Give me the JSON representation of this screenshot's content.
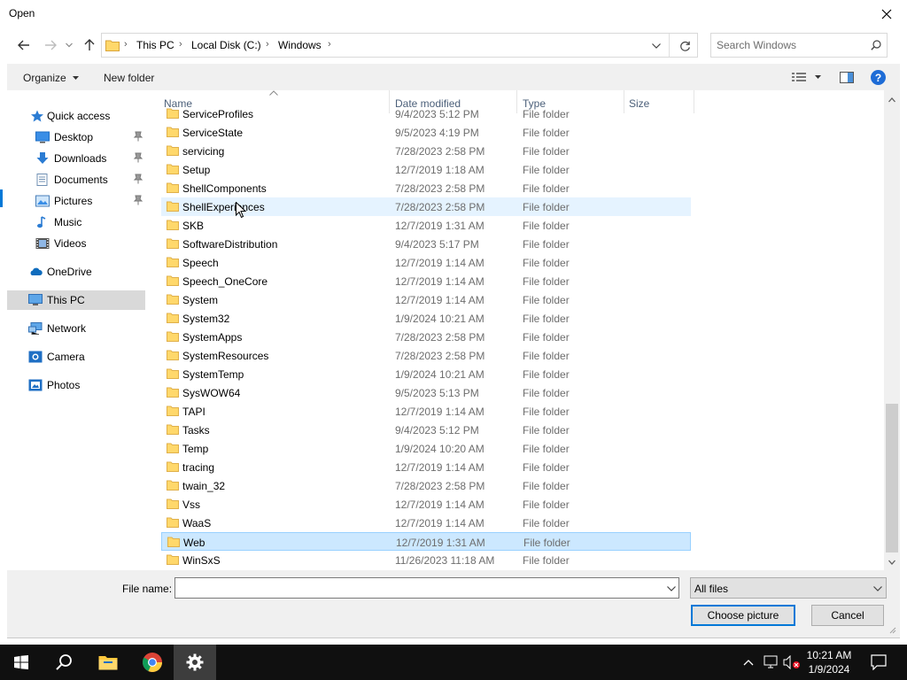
{
  "window": {
    "title": "Open",
    "close_glyph": "✕"
  },
  "nav": {
    "back_icon": "back-arrow-icon",
    "forward_icon": "forward-arrow-icon",
    "recent_icon": "chevron-down-icon",
    "up_icon": "up-arrow-icon",
    "breadcrumb": [
      "This PC",
      "Local Disk (C:)",
      "Windows"
    ],
    "search_placeholder": "Search Windows"
  },
  "toolbar": {
    "organize_label": "Organize",
    "new_folder_label": "New folder",
    "help_glyph": "?"
  },
  "sidebar": {
    "items": [
      {
        "label": "Quick access",
        "icon": "star-icon"
      },
      {
        "label": "Desktop",
        "icon": "desktop-icon",
        "pinned": true
      },
      {
        "label": "Downloads",
        "icon": "download-icon",
        "pinned": true
      },
      {
        "label": "Documents",
        "icon": "documents-icon",
        "pinned": true
      },
      {
        "label": "Pictures",
        "icon": "pictures-icon",
        "pinned": true
      },
      {
        "label": "Music",
        "icon": "music-icon"
      },
      {
        "label": "Videos",
        "icon": "videos-icon"
      },
      {
        "label": "OneDrive",
        "icon": "cloud-icon"
      },
      {
        "label": "This PC",
        "icon": "computer-icon",
        "selected": true
      },
      {
        "label": "Network",
        "icon": "network-icon"
      },
      {
        "label": "Camera",
        "icon": "camera-icon"
      },
      {
        "label": "Photos",
        "icon": "photos-icon"
      }
    ]
  },
  "columns": {
    "name": "Name",
    "date": "Date modified",
    "type": "Type",
    "size": "Size"
  },
  "files": [
    {
      "name": "ServiceProfiles",
      "date": "9/4/2023 5:12 PM",
      "type": "File folder"
    },
    {
      "name": "ServiceState",
      "date": "9/5/2023 4:19 PM",
      "type": "File folder"
    },
    {
      "name": "servicing",
      "date": "7/28/2023 2:58 PM",
      "type": "File folder"
    },
    {
      "name": "Setup",
      "date": "12/7/2019 1:18 AM",
      "type": "File folder"
    },
    {
      "name": "ShellComponents",
      "date": "7/28/2023 2:58 PM",
      "type": "File folder"
    },
    {
      "name": "ShellExperiences",
      "date": "7/28/2023 2:58 PM",
      "type": "File folder",
      "state": "hover"
    },
    {
      "name": "SKB",
      "date": "12/7/2019 1:31 AM",
      "type": "File folder"
    },
    {
      "name": "SoftwareDistribution",
      "date": "9/4/2023 5:17 PM",
      "type": "File folder"
    },
    {
      "name": "Speech",
      "date": "12/7/2019 1:14 AM",
      "type": "File folder"
    },
    {
      "name": "Speech_OneCore",
      "date": "12/7/2019 1:14 AM",
      "type": "File folder"
    },
    {
      "name": "System",
      "date": "12/7/2019 1:14 AM",
      "type": "File folder"
    },
    {
      "name": "System32",
      "date": "1/9/2024 10:21 AM",
      "type": "File folder"
    },
    {
      "name": "SystemApps",
      "date": "7/28/2023 2:58 PM",
      "type": "File folder"
    },
    {
      "name": "SystemResources",
      "date": "7/28/2023 2:58 PM",
      "type": "File folder"
    },
    {
      "name": "SystemTemp",
      "date": "1/9/2024 10:21 AM",
      "type": "File folder"
    },
    {
      "name": "SysWOW64",
      "date": "9/5/2023 5:13 PM",
      "type": "File folder"
    },
    {
      "name": "TAPI",
      "date": "12/7/2019 1:14 AM",
      "type": "File folder"
    },
    {
      "name": "Tasks",
      "date": "9/4/2023 5:12 PM",
      "type": "File folder"
    },
    {
      "name": "Temp",
      "date": "1/9/2024 10:20 AM",
      "type": "File folder"
    },
    {
      "name": "tracing",
      "date": "12/7/2019 1:14 AM",
      "type": "File folder"
    },
    {
      "name": "twain_32",
      "date": "7/28/2023 2:58 PM",
      "type": "File folder"
    },
    {
      "name": "Vss",
      "date": "12/7/2019 1:14 AM",
      "type": "File folder"
    },
    {
      "name": "WaaS",
      "date": "12/7/2019 1:14 AM",
      "type": "File folder"
    },
    {
      "name": "Web",
      "date": "12/7/2019 1:31 AM",
      "type": "File folder",
      "state": "selected"
    },
    {
      "name": "WinSxS",
      "date": "11/26/2023 11:18 AM",
      "type": "File folder"
    }
  ],
  "bottom": {
    "file_name_label": "File name:",
    "file_name_value": "",
    "file_type_selected": "All files",
    "choose_label": "Choose picture",
    "cancel_label": "Cancel"
  },
  "taskbar": {
    "apps": [
      "start-icon",
      "search-icon",
      "file-explorer-icon",
      "chrome-icon",
      "settings-icon"
    ],
    "active_app": "settings-icon",
    "time": "10:21 AM",
    "date": "1/9/2024"
  },
  "colors": {
    "selection_bg": "#cce8ff",
    "hover_bg": "#e5f3ff",
    "accent": "#0078d7",
    "folder_yellow": "#ffd86b"
  }
}
